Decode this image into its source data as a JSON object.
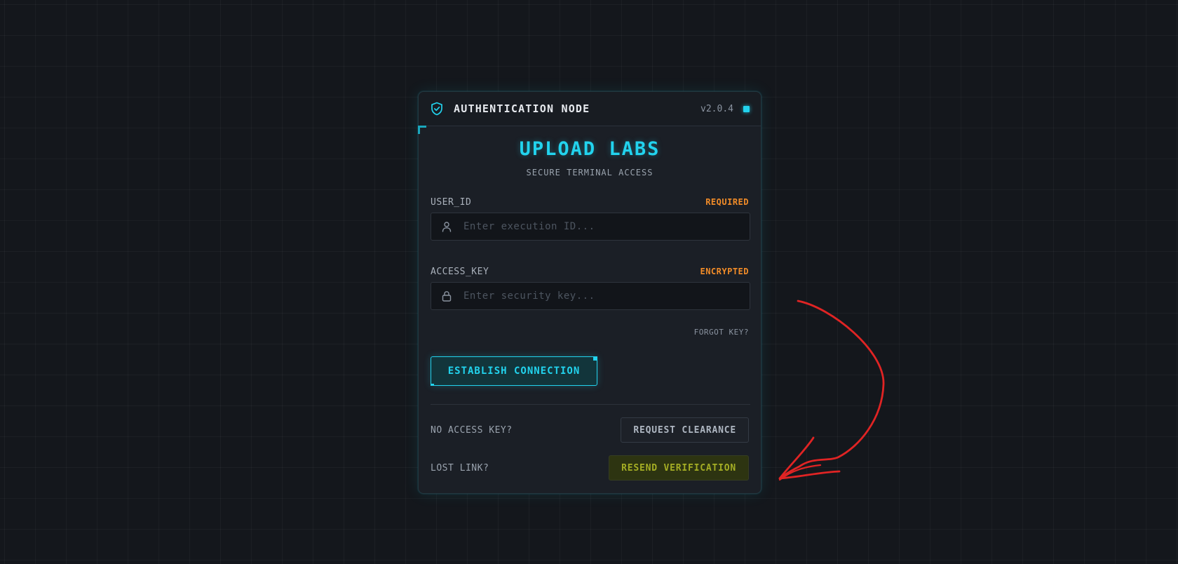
{
  "header": {
    "title": "AUTHENTICATION NODE",
    "version": "v2.0.4",
    "shield_icon": "shield-check-icon"
  },
  "brand": {
    "name": "UPLOAD LABS",
    "subtitle": "SECURE TERMINAL ACCESS"
  },
  "form": {
    "user_id": {
      "label": "USER_ID",
      "tag": "REQUIRED",
      "placeholder": "Enter execution ID...",
      "icon": "user-icon"
    },
    "access_key": {
      "label": "ACCESS_KEY",
      "tag": "ENCRYPTED",
      "placeholder": "Enter security key...",
      "icon": "lock-icon"
    },
    "forgot_label": "FORGOT KEY?",
    "submit_label": "ESTABLISH CONNECTION"
  },
  "footer": {
    "no_access_label": "NO ACCESS KEY?",
    "request_button": "REQUEST CLEARANCE",
    "lost_link_label": "LOST LINK?",
    "resend_button": "RESEND VERIFICATION"
  },
  "colors": {
    "accent": "#22d3ee",
    "warning": "#f28c28",
    "background": "#14171c",
    "annotation": "#e02424",
    "highlight": "#a4ad24"
  }
}
